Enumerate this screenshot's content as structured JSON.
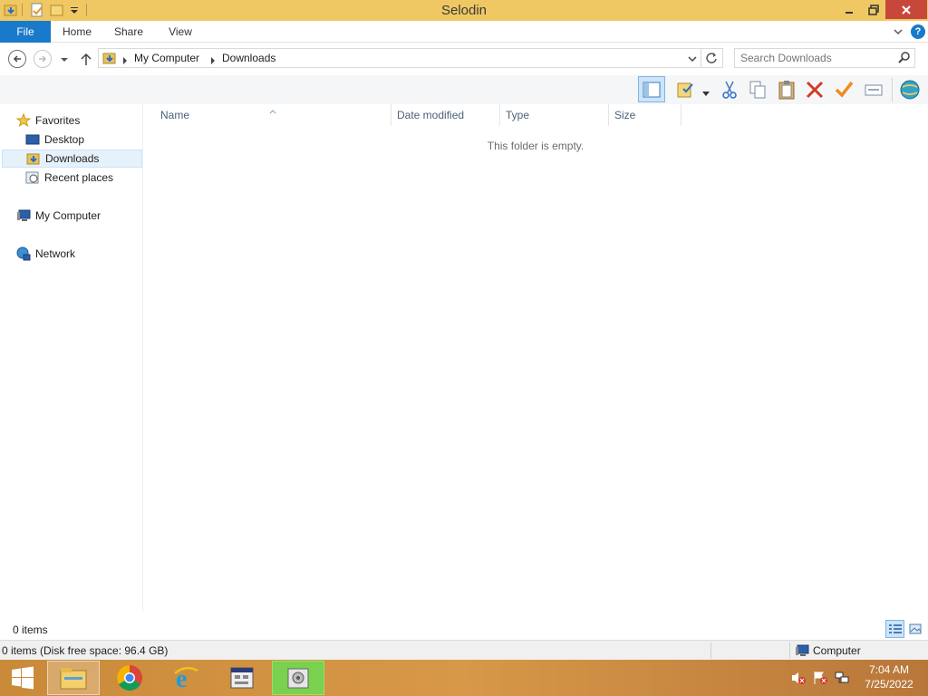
{
  "window": {
    "title": "Selodin"
  },
  "ribbon": {
    "tabs": [
      "File",
      "Home",
      "Share",
      "View"
    ]
  },
  "address": {
    "breadcrumb": [
      "My Computer",
      "Downloads"
    ],
    "search_placeholder": "Search Downloads"
  },
  "toolbar": {
    "icons": [
      "preview-pane-icon",
      "properties-icon",
      "cut-icon",
      "copy-icon",
      "paste-icon",
      "delete-icon",
      "check-icon",
      "rename-icon",
      "globe-icon"
    ]
  },
  "nav": {
    "favorites": "Favorites",
    "desktop": "Desktop",
    "downloads": "Downloads",
    "recent": "Recent places",
    "computer": "My Computer",
    "network": "Network"
  },
  "content": {
    "columns": [
      "Name",
      "Date modified",
      "Type",
      "Size"
    ],
    "empty_message": "This folder is empty."
  },
  "status": {
    "items_count": "0 items",
    "detail": "0 items (Disk free space: 96.4 GB)",
    "location": "Computer"
  },
  "taskbar": {
    "time": "7:04 AM",
    "date": "7/25/2022"
  },
  "colors": {
    "titlebar": "#f0c863",
    "file_tab": "#1979ca",
    "close_button": "#c7483b",
    "taskbar": "#d79848"
  }
}
